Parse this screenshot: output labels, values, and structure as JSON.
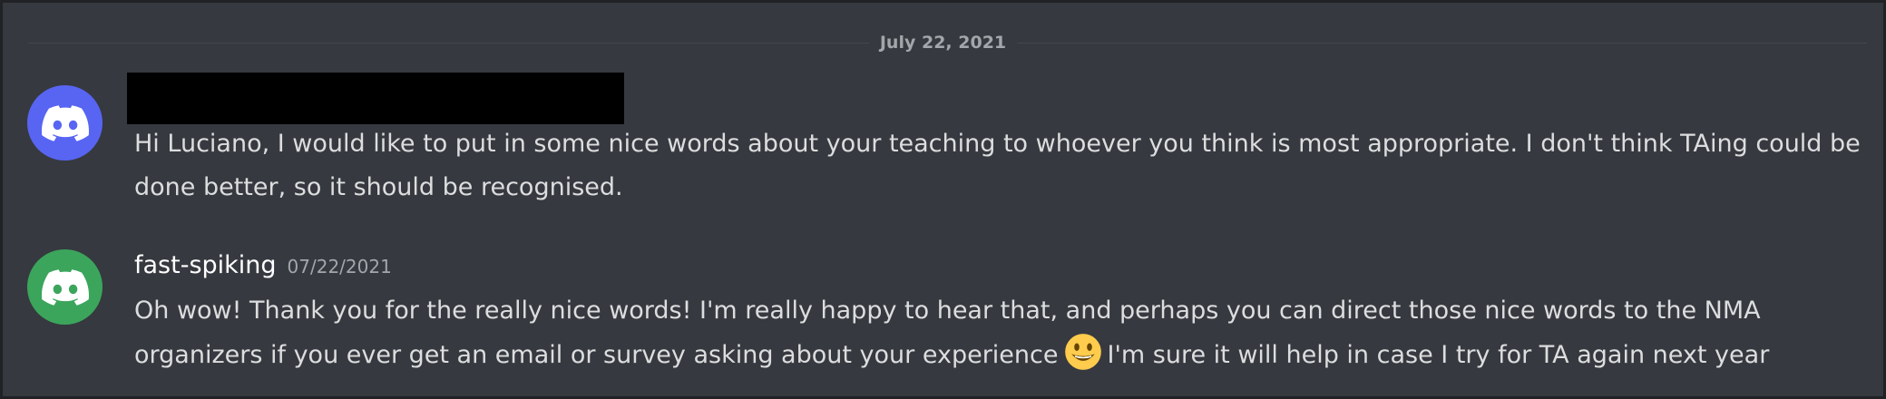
{
  "divider": {
    "date_label": "July 22, 2021"
  },
  "messages": [
    {
      "avatar_icon": "discord-logo-icon",
      "avatar_color": "#5865f2",
      "username_redacted": true,
      "text": "Hi Luciano, I would like to put in some nice words about your teaching to whoever you think is most appropriate. I don't think TAing could be done better, so it should be recognised."
    },
    {
      "avatar_icon": "discord-logo-icon",
      "avatar_color": "#3ba55c",
      "username": "fast-spiking",
      "timestamp": "07/22/2021",
      "text_before_emoji": "Oh wow! Thank you for the really nice words! I'm really happy to hear that, and perhaps you can direct those nice words to the NMA organizers if you ever get an email or survey asking about your experience",
      "emoji_icon": "smiley-emoji-icon",
      "text_after_emoji": "I'm sure it will help in case I try for TA again next year"
    }
  ]
}
